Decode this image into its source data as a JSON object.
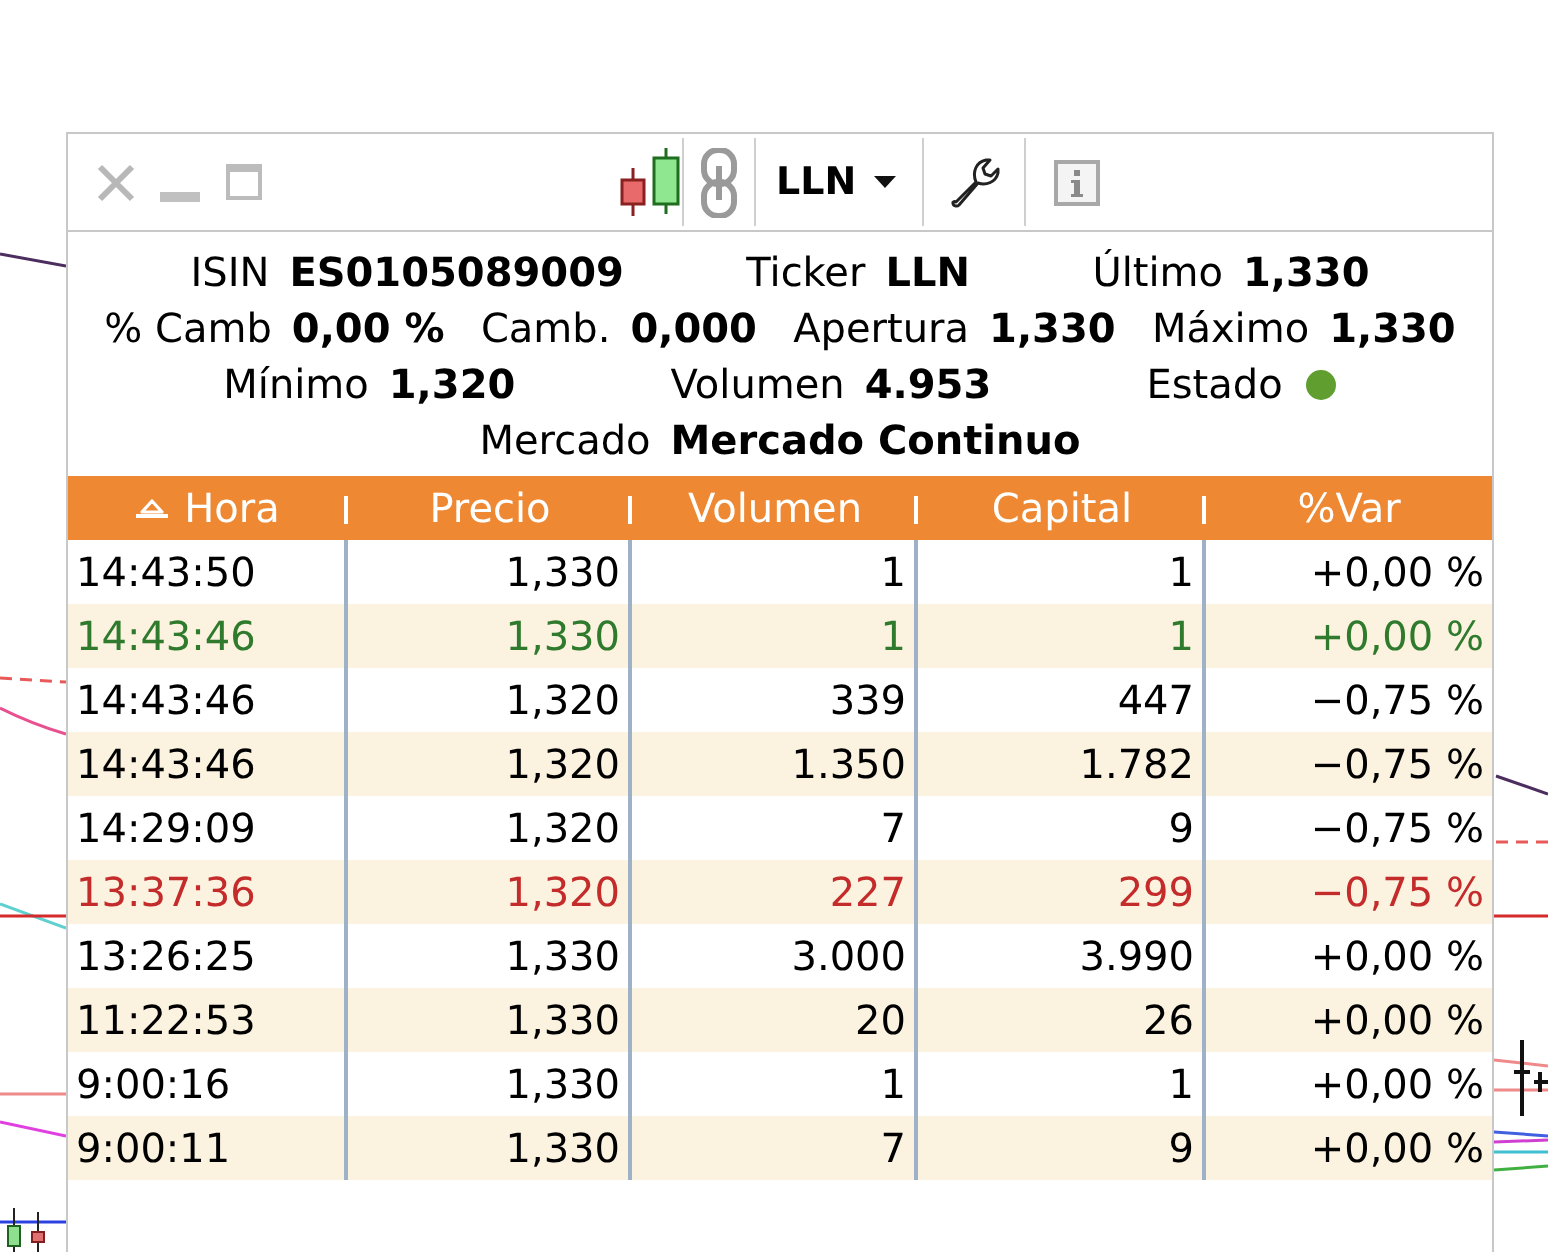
{
  "toolbar": {
    "symbol": "LLN"
  },
  "quote": {
    "lines": [
      [
        {
          "kind": "text",
          "label": "ISIN",
          "value": "ES0105089009"
        },
        {
          "kind": "text",
          "label": "Ticker",
          "value": "LLN"
        },
        {
          "kind": "text",
          "label": "Último",
          "value": "1,330"
        }
      ],
      [
        {
          "kind": "text",
          "label": "% Camb",
          "value": "0,00 %"
        },
        {
          "kind": "text",
          "label": "Camb.",
          "value": "0,000"
        },
        {
          "kind": "text",
          "label": "Apertura",
          "value": "1,330"
        },
        {
          "kind": "text",
          "label": "Máximo",
          "value": "1,330"
        }
      ],
      [
        {
          "kind": "text",
          "label": "Mínimo",
          "value": "1,320"
        },
        {
          "kind": "text",
          "label": "Volumen",
          "value": "4.953"
        },
        {
          "kind": "status",
          "label": "Estado",
          "color": "#5f9e2f"
        }
      ],
      [
        {
          "kind": "text",
          "label": "Mercado",
          "value": "Mercado Continuo"
        }
      ]
    ]
  },
  "table": {
    "columns": [
      {
        "label": "Hora",
        "sorted": true
      },
      {
        "label": "Precio",
        "sorted": false
      },
      {
        "label": "Volumen",
        "sorted": false
      },
      {
        "label": "Capital",
        "sorted": false
      },
      {
        "label": "%Var",
        "sorted": false
      }
    ],
    "rows": [
      {
        "color": "#000000",
        "cells": [
          "14:43:50",
          "1,330",
          "1",
          "1",
          "+0,00 %"
        ]
      },
      {
        "color": "#2f7a2c",
        "cells": [
          "14:43:46",
          "1,330",
          "1",
          "1",
          "+0,00 %"
        ]
      },
      {
        "color": "#000000",
        "cells": [
          "14:43:46",
          "1,320",
          "339",
          "447",
          "−0,75 %"
        ]
      },
      {
        "color": "#000000",
        "cells": [
          "14:43:46",
          "1,320",
          "1.350",
          "1.782",
          "−0,75 %"
        ]
      },
      {
        "color": "#000000",
        "cells": [
          "14:29:09",
          "1,320",
          "7",
          "9",
          "−0,75 %"
        ]
      },
      {
        "color": "#c42b2b",
        "cells": [
          "13:37:36",
          "1,320",
          "227",
          "299",
          "−0,75 %"
        ]
      },
      {
        "color": "#000000",
        "cells": [
          "13:26:25",
          "1,330",
          "3.000",
          "3.990",
          "+0,00 %"
        ]
      },
      {
        "color": "#000000",
        "cells": [
          "11:22:53",
          "1,330",
          "20",
          "26",
          "+0,00 %"
        ]
      },
      {
        "color": "#000000",
        "cells": [
          "9:00:16",
          "1,330",
          "1",
          "1",
          "+0,00 %"
        ]
      },
      {
        "color": "#000000",
        "cells": [
          "9:00:11",
          "1,330",
          "7",
          "9",
          "+0,00 %"
        ]
      }
    ]
  }
}
